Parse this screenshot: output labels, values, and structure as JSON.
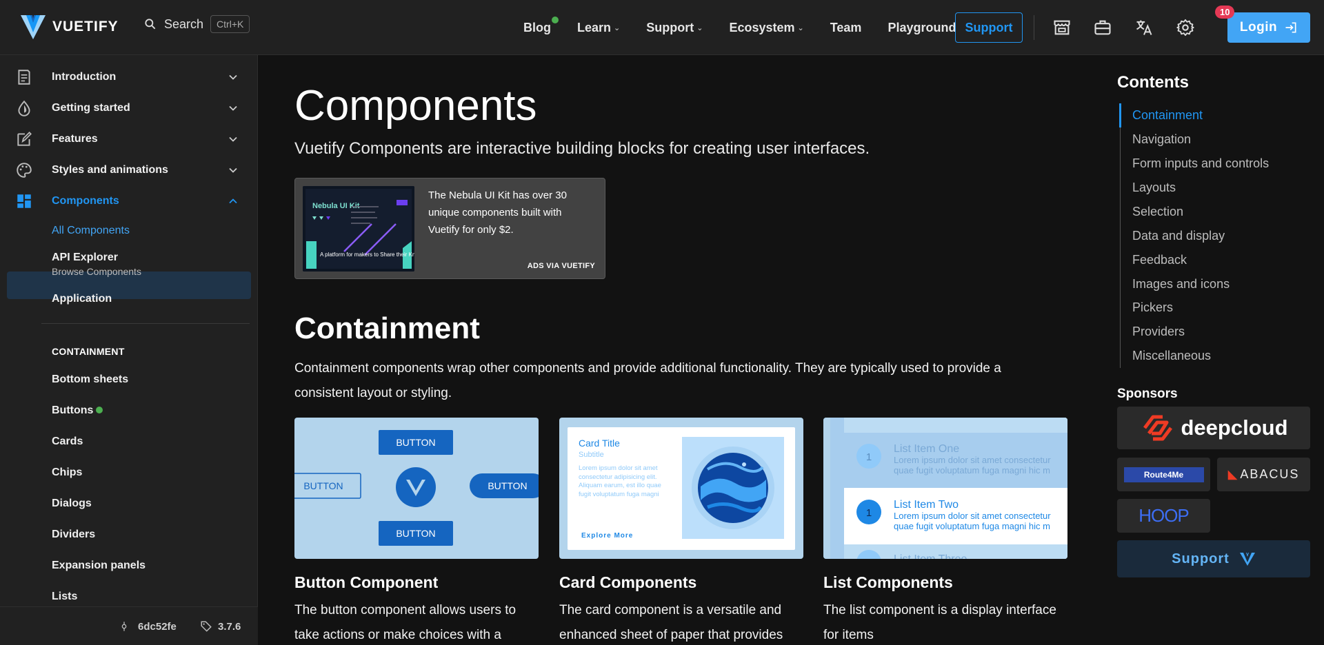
{
  "header": {
    "logo_text": "VUETIFY",
    "search_label": "Search",
    "search_shortcut": "Ctrl+K",
    "nav": [
      {
        "label": "Blog"
      },
      {
        "label": "Learn"
      },
      {
        "label": "Support"
      },
      {
        "label": "Ecosystem"
      },
      {
        "label": "Team"
      },
      {
        "label": "Playground"
      }
    ],
    "support_button": "Support",
    "notification_count": "10",
    "login_label": "Login"
  },
  "sidebar": {
    "sections": [
      {
        "label": "Introduction",
        "icon": "document-icon"
      },
      {
        "label": "Getting started",
        "icon": "water-drop-icon"
      },
      {
        "label": "Features",
        "icon": "edit-icon"
      },
      {
        "label": "Styles and animations",
        "icon": "palette-icon"
      },
      {
        "label": "Components",
        "icon": "dashboard-icon"
      }
    ],
    "sub_items": {
      "all_components": "All Components",
      "api_explorer": "API Explorer",
      "api_explorer_sub": "Browse Components",
      "application": "Application"
    },
    "group_header": "CONTAINMENT",
    "containment_items": [
      "Bottom sheets",
      "Buttons",
      "Cards",
      "Chips",
      "Dialogs",
      "Dividers",
      "Expansion panels",
      "Lists"
    ],
    "footer": {
      "commit": "6dc52fe",
      "version": "3.7.6"
    }
  },
  "main": {
    "title": "Components",
    "lead": "Vuetify Components are interactive building blocks for creating user interfaces.",
    "ad": {
      "text": "The Nebula UI Kit has over 30 unique components built with Vuetify for only $2.",
      "via": "ADS VIA VUETIFY",
      "image_title": "Nebula UI Kit",
      "image_caption": "A platform for makers to Share their Knowledge"
    },
    "section_title": "Containment",
    "section_text": "Containment components wrap other components and provide additional functionality. They are typically used to provide a consistent layout or styling.",
    "cards": [
      {
        "title": "Button Component",
        "desc": "The button component allows users to take actions or make choices with a"
      },
      {
        "title": "Card Components",
        "desc": "The card component is a versatile and enhanced sheet of paper that provides"
      },
      {
        "title": "List Components",
        "desc": "The list component is a display interface for items"
      }
    ],
    "button_preview": {
      "label": "BUTTON"
    },
    "card_preview": {
      "title": "Card Title",
      "subtitle": "Subtitle",
      "body": "Lorem ipsum dolor sit amet consectetur adipisicing elit. Aliquam earum, est illo quae fugit voluptatum fuga magni",
      "action": "Explore More"
    },
    "list_preview": {
      "items": [
        {
          "num": "1",
          "title": "List Item One",
          "body1": "Lorem ipsum dolor sit amet consectetur",
          "body2": "quae fugit voluptatum fuga magni hic m"
        },
        {
          "num": "1",
          "title": "List Item Two",
          "body1": "Lorem ipsum dolor sit amet consectetur",
          "body2": "quae fugit voluptatum fuga magni hic m"
        },
        {
          "title": "List Item Three"
        }
      ]
    }
  },
  "toc": {
    "title": "Contents",
    "items": [
      "Containment",
      "Navigation",
      "Form inputs and controls",
      "Layouts",
      "Selection",
      "Data and display",
      "Feedback",
      "Images and icons",
      "Pickers",
      "Providers",
      "Miscellaneous"
    ]
  },
  "sponsors": {
    "title": "Sponsors",
    "names": [
      "deepcloud",
      "Route4Me",
      "ABACUS",
      "HOOP"
    ],
    "support_label": "Support"
  },
  "colors": {
    "accent": "#2196f3",
    "background": "#121212",
    "surface": "#212121",
    "badge": "#e53955",
    "online": "#4caf50"
  }
}
